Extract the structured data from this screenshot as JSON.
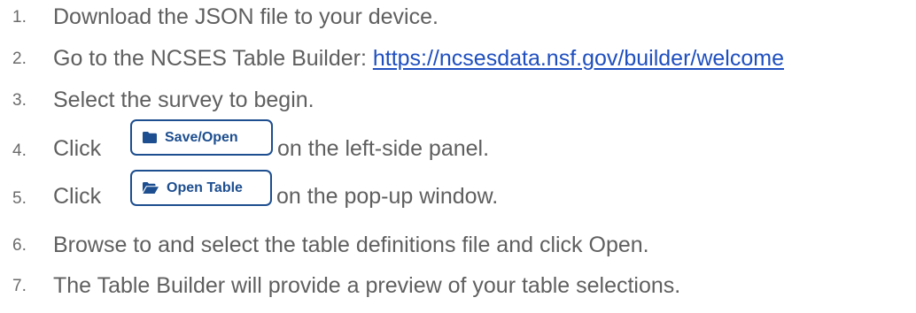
{
  "steps": [
    {
      "num": "1.",
      "text": "Download the JSON file to your device."
    },
    {
      "num": "2.",
      "text_before": "Go to the NCSES Table Builder: ",
      "link": "https://ncsesdata.nsf.gov/builder/welcome"
    },
    {
      "num": "3.",
      "text": "Select the survey to begin."
    },
    {
      "num": "4.",
      "text_before": "Click",
      "button": "Save/Open",
      "button_icon": "folder-icon",
      "text_after": "on the left-side panel."
    },
    {
      "num": "5.",
      "text_before": "Click",
      "button": "Open Table",
      "button_icon": "folder-open-icon",
      "text_after": "on the pop-up window."
    },
    {
      "num": "6.",
      "text": "Browse to and select the table definitions file and click Open."
    },
    {
      "num": "7.",
      "text": "The Table Builder will provide a preview of your table selections."
    }
  ],
  "colors": {
    "text": "#5f5f5f",
    "link": "#1f4fbf",
    "button": "#1d4e8f"
  }
}
